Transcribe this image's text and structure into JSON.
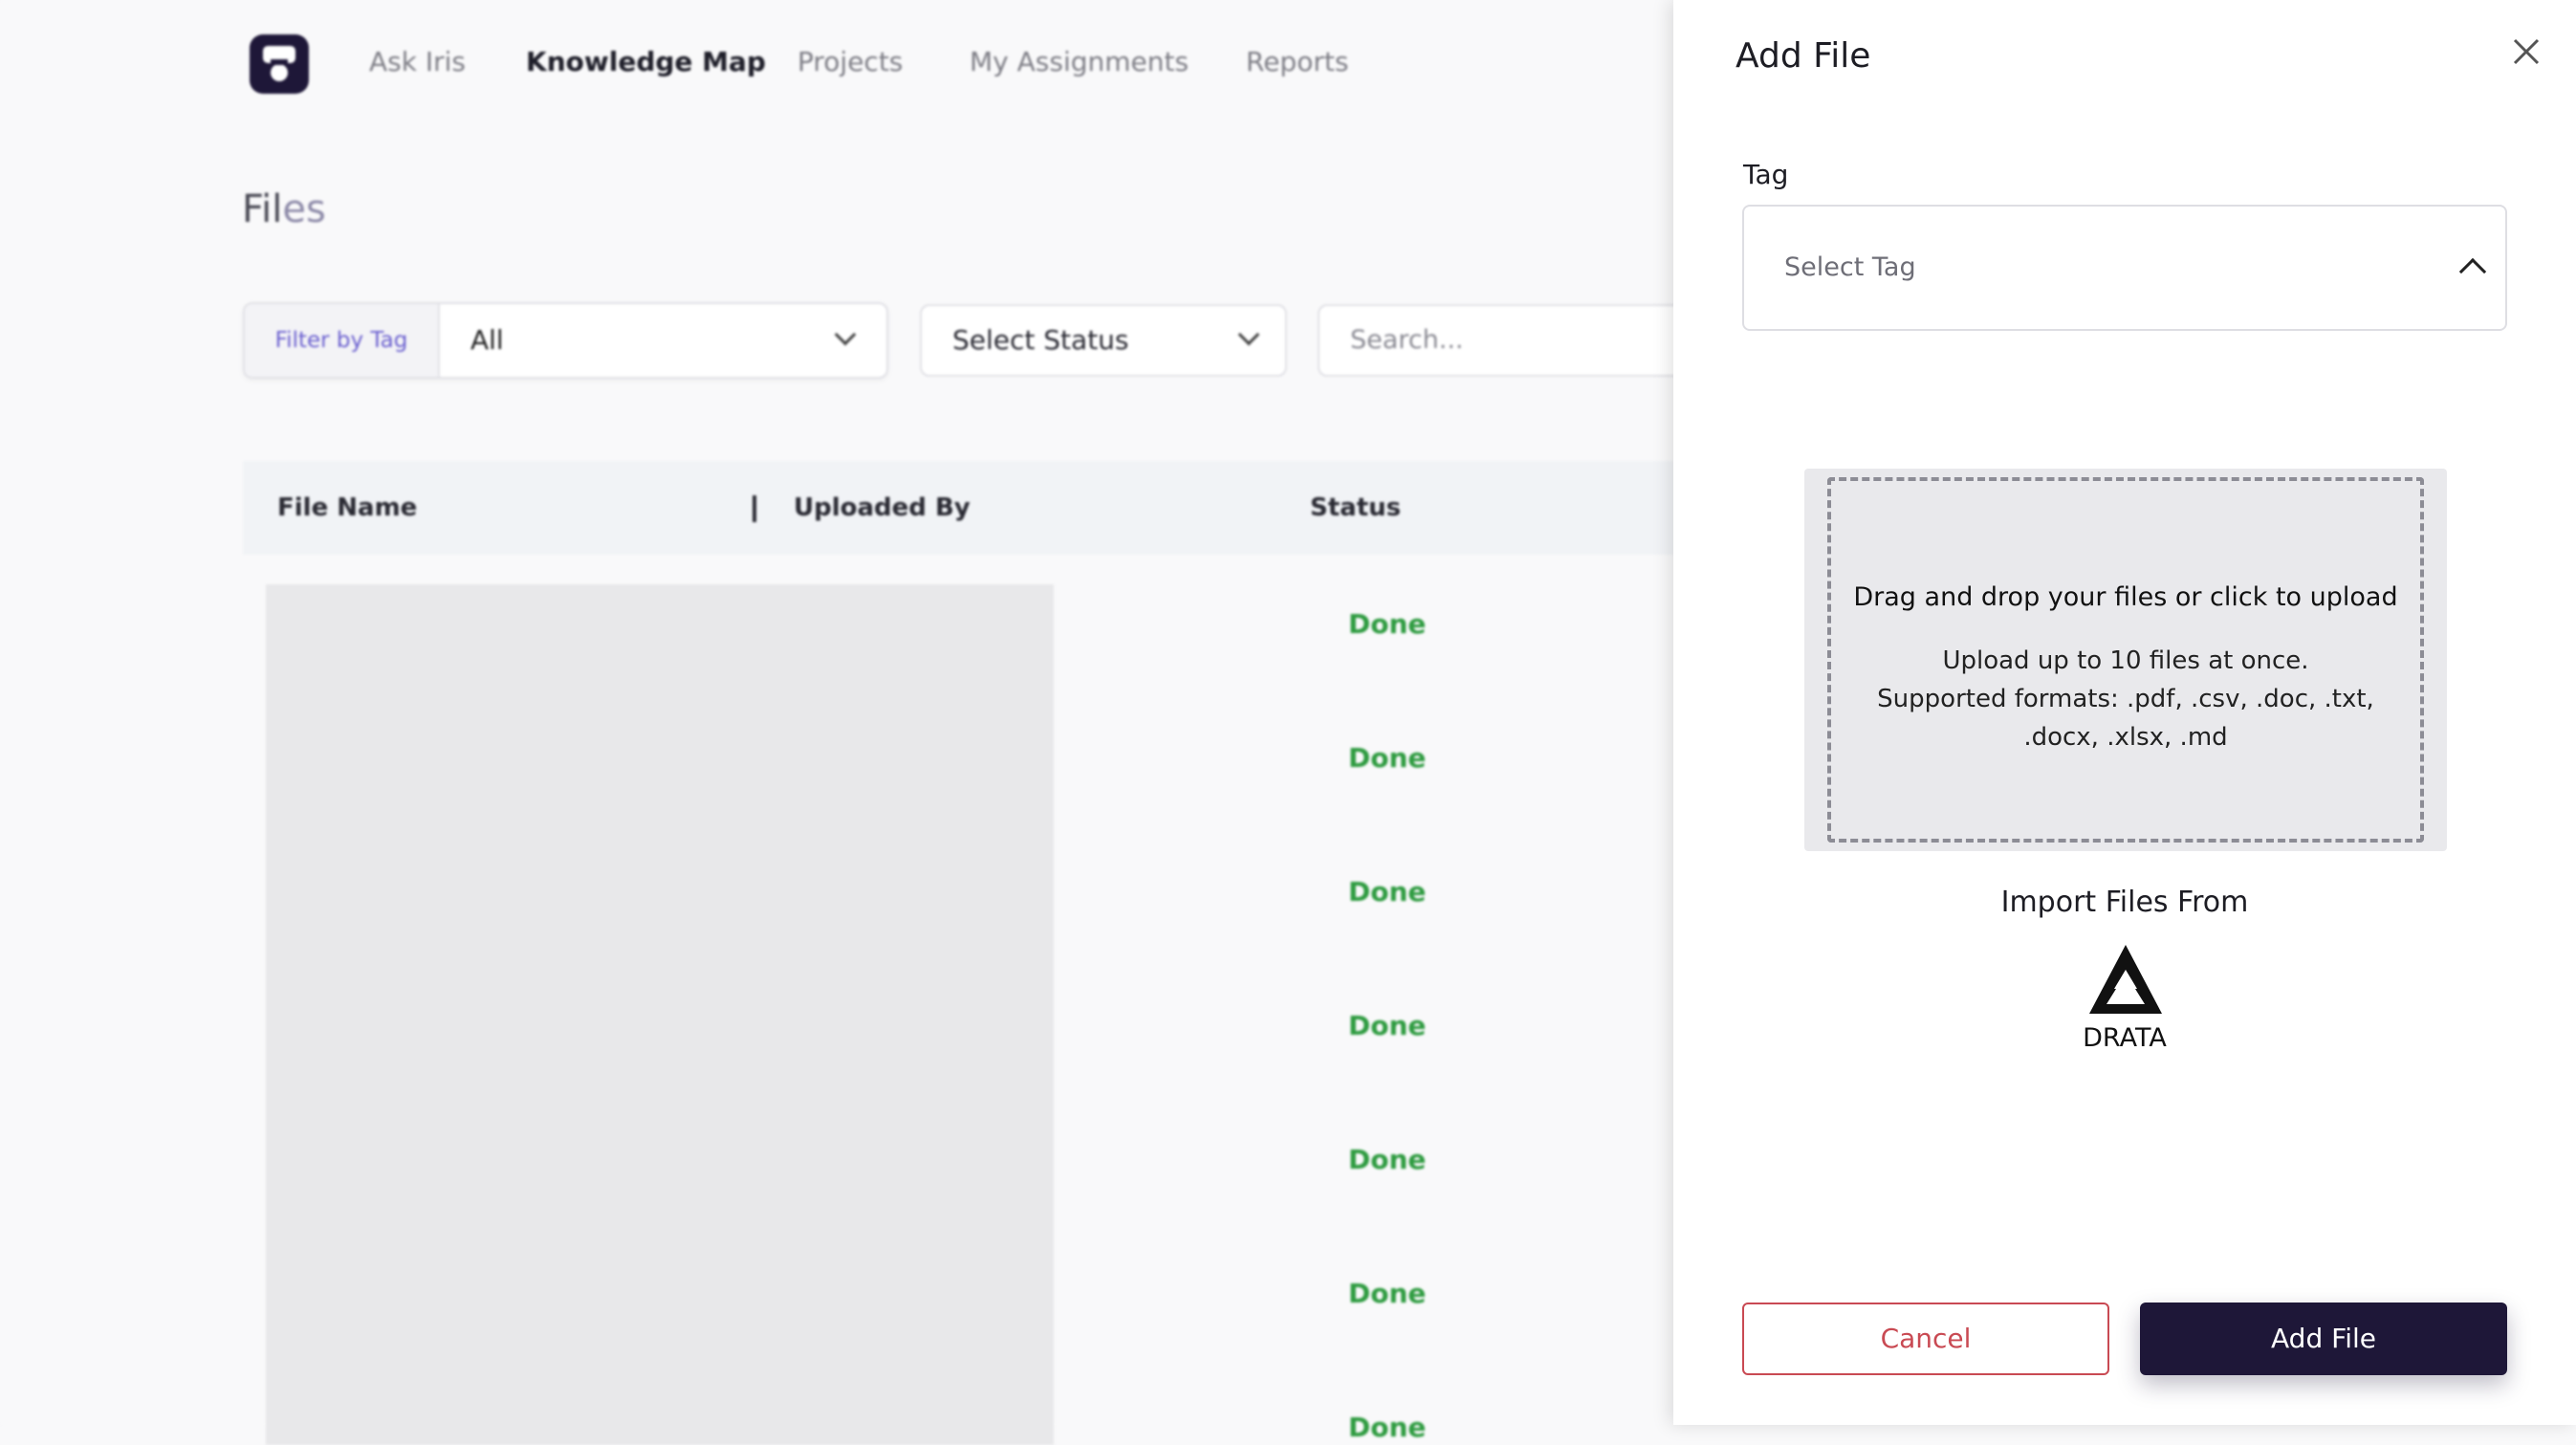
{
  "nav": {
    "items": [
      {
        "label": "Ask Iris"
      },
      {
        "label": "Knowledge Map"
      },
      {
        "label": "Projects"
      },
      {
        "label": "My Assignments"
      },
      {
        "label": "Reports"
      }
    ],
    "active": "Knowledge Map"
  },
  "page": {
    "title_main": "Fil",
    "title_fade": "es"
  },
  "filters": {
    "tag_label": "Filter by Tag",
    "tag_value": "All",
    "status_placeholder": "Select Status",
    "search_placeholder": "Search..."
  },
  "table": {
    "columns": [
      "File Name",
      "Uploaded By",
      "Status"
    ],
    "statuses": [
      "Done",
      "Done",
      "Done",
      "Done",
      "Done",
      "Done",
      "Done"
    ]
  },
  "drawer": {
    "title": "Add File",
    "tag_label": "Tag",
    "tag_placeholder": "Select Tag",
    "dropzone_heading": "Drag and drop your files or click to upload",
    "dropzone_line1": "Upload up to 10 files at once.",
    "dropzone_line2": "Supported formats: .pdf, .csv, .doc, .txt, .docx, .xlsx, .md",
    "import_heading": "Import Files From",
    "import_source": "DRATA",
    "cancel_label": "Cancel",
    "submit_label": "Add File"
  },
  "colors": {
    "brand": "#1e1738",
    "done": "#2e9b40",
    "cancel": "#c94a53",
    "filter_label": "#6a5fcf"
  },
  "icons": {
    "logo": "iris-logo-icon",
    "close": "close-icon",
    "dropdown": "chevron-down-icon",
    "dropdown_open": "chevron-up-icon",
    "import": "drata-logo-icon"
  }
}
